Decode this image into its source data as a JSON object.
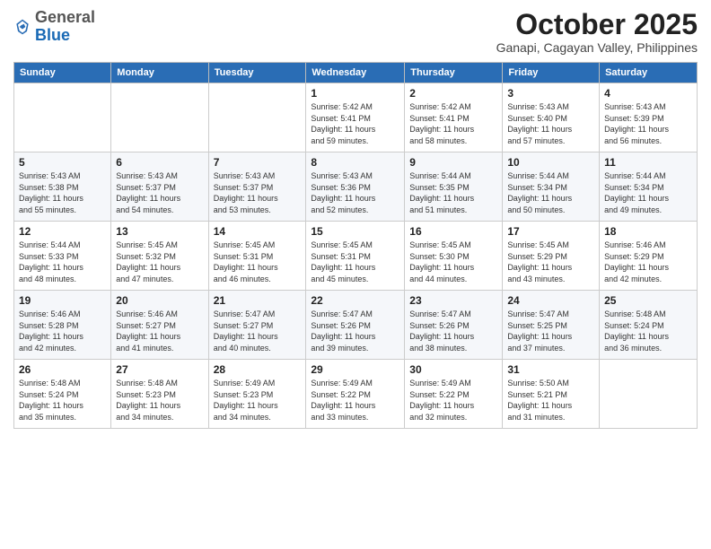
{
  "header": {
    "logo": {
      "general": "General",
      "blue": "Blue"
    },
    "title": "October 2025",
    "subtitle": "Ganapi, Cagayan Valley, Philippines"
  },
  "weekdays": [
    "Sunday",
    "Monday",
    "Tuesday",
    "Wednesday",
    "Thursday",
    "Friday",
    "Saturday"
  ],
  "weeks": [
    [
      {
        "day": "",
        "info": ""
      },
      {
        "day": "",
        "info": ""
      },
      {
        "day": "",
        "info": ""
      },
      {
        "day": "1",
        "info": "Sunrise: 5:42 AM\nSunset: 5:41 PM\nDaylight: 11 hours\nand 59 minutes."
      },
      {
        "day": "2",
        "info": "Sunrise: 5:42 AM\nSunset: 5:41 PM\nDaylight: 11 hours\nand 58 minutes."
      },
      {
        "day": "3",
        "info": "Sunrise: 5:43 AM\nSunset: 5:40 PM\nDaylight: 11 hours\nand 57 minutes."
      },
      {
        "day": "4",
        "info": "Sunrise: 5:43 AM\nSunset: 5:39 PM\nDaylight: 11 hours\nand 56 minutes."
      }
    ],
    [
      {
        "day": "5",
        "info": "Sunrise: 5:43 AM\nSunset: 5:38 PM\nDaylight: 11 hours\nand 55 minutes."
      },
      {
        "day": "6",
        "info": "Sunrise: 5:43 AM\nSunset: 5:37 PM\nDaylight: 11 hours\nand 54 minutes."
      },
      {
        "day": "7",
        "info": "Sunrise: 5:43 AM\nSunset: 5:37 PM\nDaylight: 11 hours\nand 53 minutes."
      },
      {
        "day": "8",
        "info": "Sunrise: 5:43 AM\nSunset: 5:36 PM\nDaylight: 11 hours\nand 52 minutes."
      },
      {
        "day": "9",
        "info": "Sunrise: 5:44 AM\nSunset: 5:35 PM\nDaylight: 11 hours\nand 51 minutes."
      },
      {
        "day": "10",
        "info": "Sunrise: 5:44 AM\nSunset: 5:34 PM\nDaylight: 11 hours\nand 50 minutes."
      },
      {
        "day": "11",
        "info": "Sunrise: 5:44 AM\nSunset: 5:34 PM\nDaylight: 11 hours\nand 49 minutes."
      }
    ],
    [
      {
        "day": "12",
        "info": "Sunrise: 5:44 AM\nSunset: 5:33 PM\nDaylight: 11 hours\nand 48 minutes."
      },
      {
        "day": "13",
        "info": "Sunrise: 5:45 AM\nSunset: 5:32 PM\nDaylight: 11 hours\nand 47 minutes."
      },
      {
        "day": "14",
        "info": "Sunrise: 5:45 AM\nSunset: 5:31 PM\nDaylight: 11 hours\nand 46 minutes."
      },
      {
        "day": "15",
        "info": "Sunrise: 5:45 AM\nSunset: 5:31 PM\nDaylight: 11 hours\nand 45 minutes."
      },
      {
        "day": "16",
        "info": "Sunrise: 5:45 AM\nSunset: 5:30 PM\nDaylight: 11 hours\nand 44 minutes."
      },
      {
        "day": "17",
        "info": "Sunrise: 5:45 AM\nSunset: 5:29 PM\nDaylight: 11 hours\nand 43 minutes."
      },
      {
        "day": "18",
        "info": "Sunrise: 5:46 AM\nSunset: 5:29 PM\nDaylight: 11 hours\nand 42 minutes."
      }
    ],
    [
      {
        "day": "19",
        "info": "Sunrise: 5:46 AM\nSunset: 5:28 PM\nDaylight: 11 hours\nand 42 minutes."
      },
      {
        "day": "20",
        "info": "Sunrise: 5:46 AM\nSunset: 5:27 PM\nDaylight: 11 hours\nand 41 minutes."
      },
      {
        "day": "21",
        "info": "Sunrise: 5:47 AM\nSunset: 5:27 PM\nDaylight: 11 hours\nand 40 minutes."
      },
      {
        "day": "22",
        "info": "Sunrise: 5:47 AM\nSunset: 5:26 PM\nDaylight: 11 hours\nand 39 minutes."
      },
      {
        "day": "23",
        "info": "Sunrise: 5:47 AM\nSunset: 5:26 PM\nDaylight: 11 hours\nand 38 minutes."
      },
      {
        "day": "24",
        "info": "Sunrise: 5:47 AM\nSunset: 5:25 PM\nDaylight: 11 hours\nand 37 minutes."
      },
      {
        "day": "25",
        "info": "Sunrise: 5:48 AM\nSunset: 5:24 PM\nDaylight: 11 hours\nand 36 minutes."
      }
    ],
    [
      {
        "day": "26",
        "info": "Sunrise: 5:48 AM\nSunset: 5:24 PM\nDaylight: 11 hours\nand 35 minutes."
      },
      {
        "day": "27",
        "info": "Sunrise: 5:48 AM\nSunset: 5:23 PM\nDaylight: 11 hours\nand 34 minutes."
      },
      {
        "day": "28",
        "info": "Sunrise: 5:49 AM\nSunset: 5:23 PM\nDaylight: 11 hours\nand 34 minutes."
      },
      {
        "day": "29",
        "info": "Sunrise: 5:49 AM\nSunset: 5:22 PM\nDaylight: 11 hours\nand 33 minutes."
      },
      {
        "day": "30",
        "info": "Sunrise: 5:49 AM\nSunset: 5:22 PM\nDaylight: 11 hours\nand 32 minutes."
      },
      {
        "day": "31",
        "info": "Sunrise: 5:50 AM\nSunset: 5:21 PM\nDaylight: 11 hours\nand 31 minutes."
      },
      {
        "day": "",
        "info": ""
      }
    ]
  ]
}
